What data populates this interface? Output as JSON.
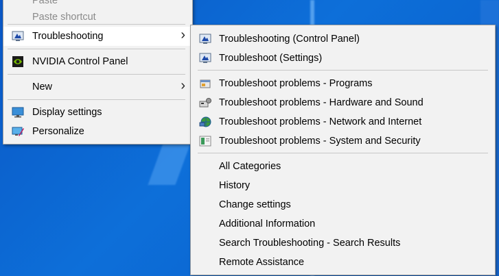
{
  "main_menu": {
    "items": [
      {
        "label": "Paste",
        "disabled": true
      },
      {
        "label": "Paste shortcut",
        "disabled": true
      },
      {
        "label": "Troubleshooting",
        "icon": "troubleshoot-icon",
        "submenu": true
      },
      {
        "label": "NVIDIA Control Panel",
        "icon": "nvidia-icon"
      },
      {
        "label": "New",
        "submenu": true
      },
      {
        "label": "Display settings",
        "icon": "display-settings-icon"
      },
      {
        "label": "Personalize",
        "icon": "personalize-icon"
      }
    ],
    "arrow": "›"
  },
  "submenu": {
    "items": [
      {
        "label": "Troubleshooting (Control Panel)",
        "icon": "troubleshoot-icon"
      },
      {
        "label": "Troubleshoot (Settings)",
        "icon": "troubleshoot-icon"
      },
      {
        "label": "Troubleshoot problems - Programs",
        "icon": "programs-icon"
      },
      {
        "label": "Troubleshoot problems - Hardware and Sound",
        "icon": "hardware-sound-icon"
      },
      {
        "label": "Troubleshoot problems - Network and Internet",
        "icon": "network-icon"
      },
      {
        "label": "Troubleshoot problems - System and Security",
        "icon": "system-security-icon"
      },
      {
        "label": "All Categories"
      },
      {
        "label": "History"
      },
      {
        "label": "Change settings"
      },
      {
        "label": "Additional Information"
      },
      {
        "label": "Search Troubleshooting - Search Results"
      },
      {
        "label": "Remote Assistance"
      }
    ]
  },
  "colors": {
    "desktop": "#0a63c7",
    "menu_bg": "#f2f2f2",
    "highlight": "#ffffff",
    "disabled_text": "#8a8a8a"
  }
}
